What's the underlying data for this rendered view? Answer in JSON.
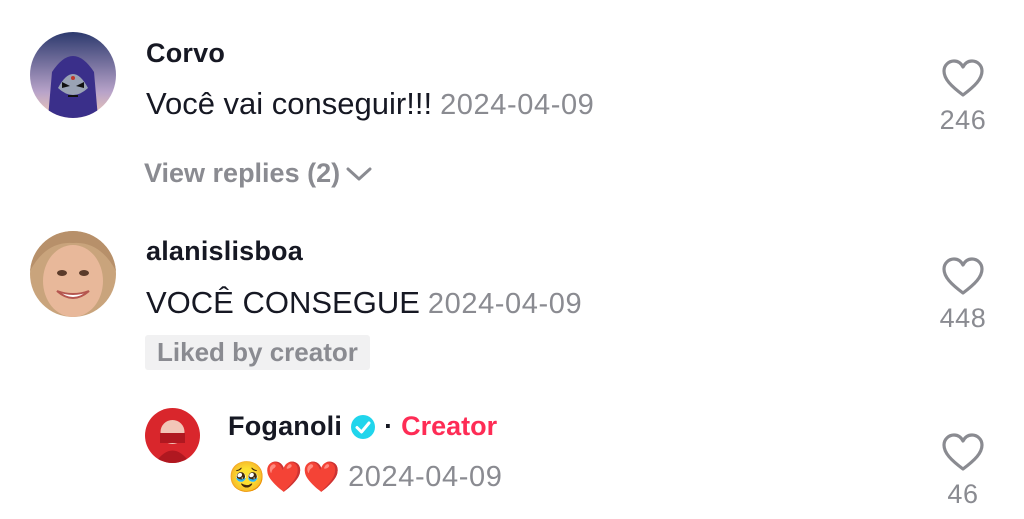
{
  "comments": [
    {
      "username": "Corvo",
      "text": "Você vai conseguir!!!",
      "date": "2024-04-09",
      "likes": "246",
      "view_replies": "View replies (2)",
      "avatar": "raven-cartoon-avatar"
    },
    {
      "username": "alanislisboa",
      "text": "VOCÊ CONSEGUE",
      "date": "2024-04-09",
      "likes": "448",
      "liked_by": "Liked by creator",
      "avatar": "smiling-woman-avatar"
    }
  ],
  "reply": {
    "username": "Foganoli",
    "verified_icon": "verified-badge-icon",
    "separator": "·",
    "creator_label": "Creator",
    "emojis": [
      "🥹",
      "❤️",
      "❤️"
    ],
    "date": "2024-04-09",
    "likes": "46",
    "avatar": "red-avatar"
  },
  "colors": {
    "creator": "#fe2c55",
    "verified": "#20d5ec",
    "muted": "#8a8b91"
  }
}
